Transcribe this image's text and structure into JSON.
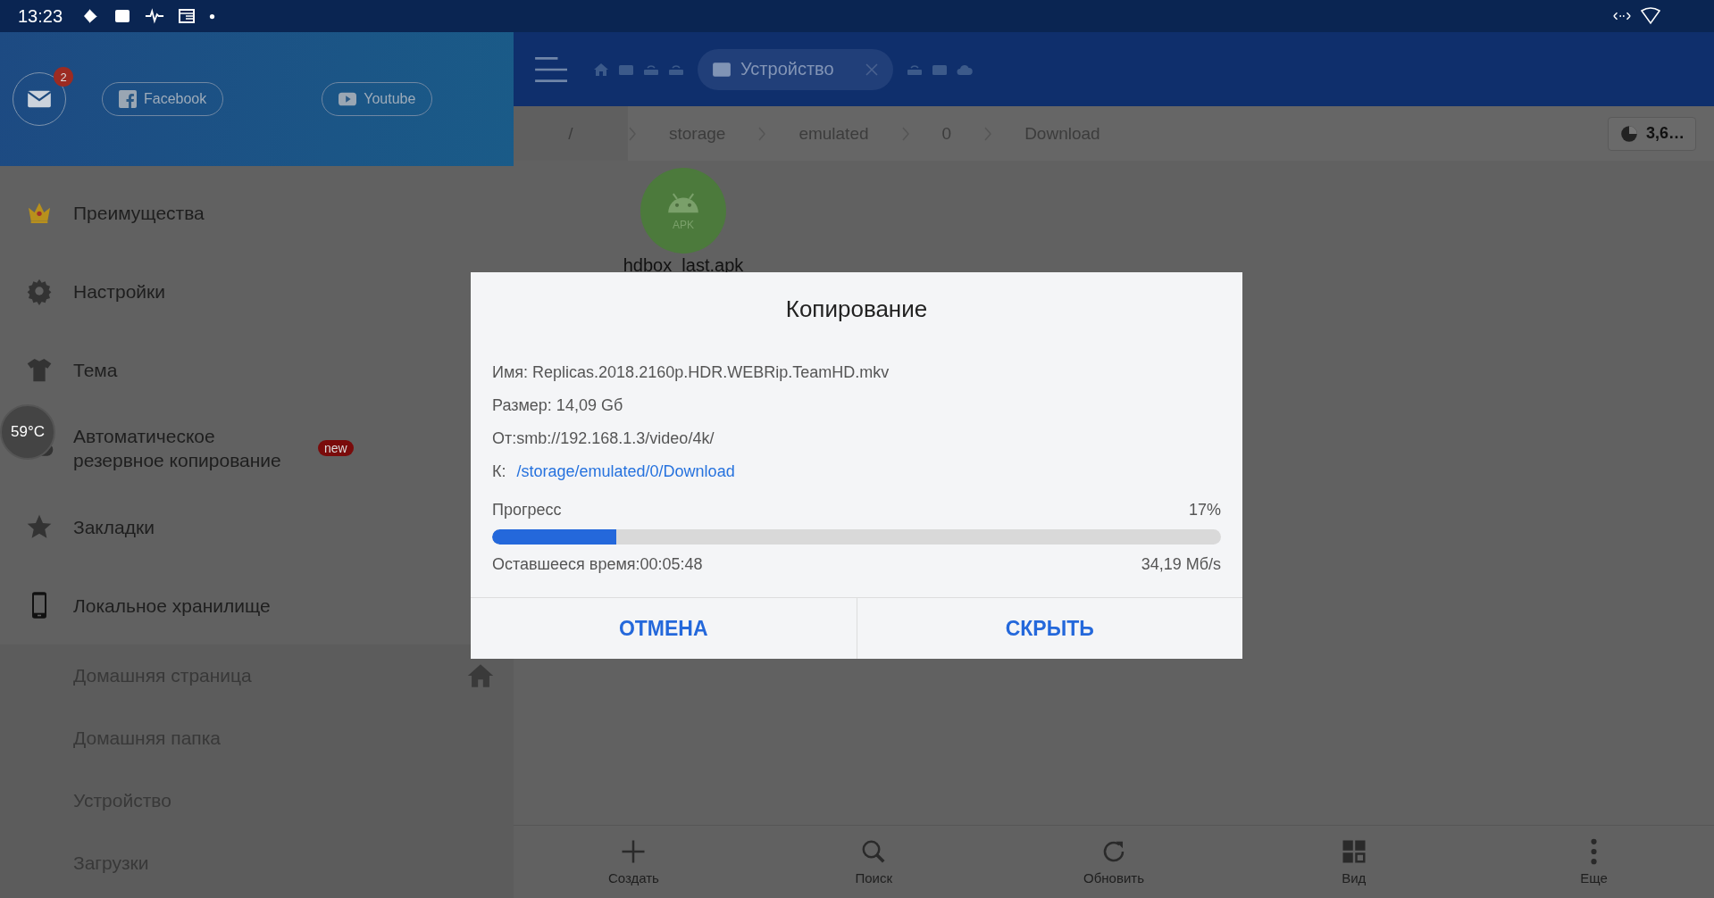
{
  "status_bar": {
    "time": "13:23"
  },
  "temperature": "59°C",
  "drawer": {
    "mail_badge": "2",
    "links": [
      {
        "label": "Facebook",
        "kind": "facebook"
      },
      {
        "label": "Youtube",
        "kind": "youtube"
      }
    ],
    "items": [
      {
        "label": "Преимущества",
        "kind": "crown"
      },
      {
        "label": "Настройки",
        "kind": "gear"
      },
      {
        "label": "Тема",
        "kind": "shirt"
      },
      {
        "label": "Автоматическое резервное копирование",
        "kind": "cloud",
        "badge": "new"
      },
      {
        "label": "Закладки",
        "kind": "star"
      },
      {
        "label": "Локальное хранилище",
        "kind": "phone",
        "children": [
          {
            "label": "Домашняя страница",
            "home": true
          },
          {
            "label": "Домашняя папка",
            "home": false
          },
          {
            "label": "Устройство",
            "home": false
          },
          {
            "label": "Загрузки",
            "home": false
          }
        ]
      }
    ]
  },
  "toolbar": {
    "active_tab": "Устройство"
  },
  "breadcrumbs": [
    {
      "label": "/",
      "selected": true
    },
    {
      "label": "storage",
      "selected": false
    },
    {
      "label": "emulated",
      "selected": false
    },
    {
      "label": "0",
      "selected": false
    },
    {
      "label": "Download",
      "selected": false
    }
  ],
  "storage": "3,6…",
  "files": [
    {
      "name": "hdbox_last.apk",
      "badge": "APK"
    }
  ],
  "dialog": {
    "title": "Копирование",
    "lines": [
      "Имя: Replicas.2018.2160p.HDR.WEBRip.TeamHD.mkv",
      "Размер: 14,09 Gб",
      "От:smb://192.168.1.3/video/4k/"
    ],
    "target_label": "К:",
    "target": "/storage/emulated/0/Download",
    "progress_label": "Прогресс",
    "percent": "17%",
    "level": 0.17,
    "remaining": "Оставшееся время:00:05:48",
    "speed": "34,19 Мб/s",
    "buttons": [
      "ОТМЕНА",
      "СКРЫТЬ"
    ]
  },
  "bottom_bar": [
    {
      "label": "Создать",
      "kind": "plus"
    },
    {
      "label": "Поиск",
      "kind": "search"
    },
    {
      "label": "Обновить",
      "kind": "refresh"
    },
    {
      "label": "Вид",
      "kind": "grid"
    },
    {
      "label": "Еще",
      "kind": "more"
    }
  ]
}
